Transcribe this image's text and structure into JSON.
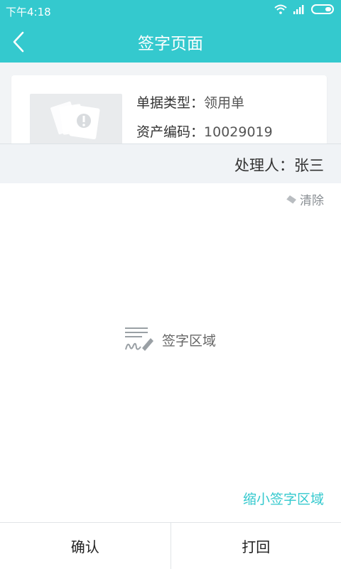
{
  "status_bar": {
    "time": "下午4:18"
  },
  "header": {
    "title": "签字页面",
    "back_icon": "chevron-left-icon"
  },
  "document": {
    "type_label": "单据类型：",
    "type_value": "领用单",
    "code_label": "资产编码：",
    "code_value": "10029019"
  },
  "handler": {
    "label": "处理人：",
    "name": "张三"
  },
  "signature": {
    "clear_label": "清除",
    "hint": "签字区域",
    "shrink_label": "缩小签字区域"
  },
  "footer": {
    "confirm_label": "确认",
    "return_label": "打回"
  },
  "colors": {
    "accent": "#34c9ce",
    "background": "#f2f4f6"
  }
}
